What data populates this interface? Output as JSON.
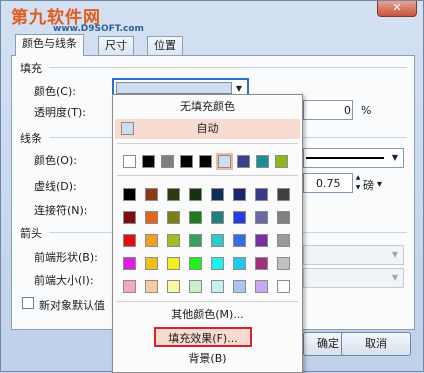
{
  "watermark": {
    "main": "第九软件网",
    "url": "www.D9SOFT.com"
  },
  "window": {
    "close_glyph": "✕"
  },
  "tabs": [
    {
      "label": "颜色与线条"
    },
    {
      "label": "尺寸"
    },
    {
      "label": "位置"
    }
  ],
  "fill": {
    "section": "填充",
    "color_label": "颜色(C):",
    "transparency_label": "透明度(T):",
    "transparency_value": "0",
    "transparency_unit": "%",
    "selected_color": "#cfddf1"
  },
  "line": {
    "section": "线条",
    "color_label": "颜色(O):",
    "dash_label": "虚线(D):",
    "connector_label": "连接符(N):",
    "weight_value": "0.75",
    "weight_unit": "磅"
  },
  "arrows": {
    "section": "箭头",
    "begin_style_label": "前端形状(B):",
    "begin_size_label": "前端大小(I):"
  },
  "default_checkbox_label": "新对象默认值",
  "buttons": {
    "ok": "确定",
    "cancel": "取消"
  },
  "popup": {
    "no_fill": "无填充颜色",
    "auto": "自动",
    "auto_color": "#cfddf1",
    "theme_colors": [
      "#ffffff",
      "#000000",
      "#7f7f7f",
      "#000000",
      "#000000",
      "#cfddf1",
      "#3a3f8f",
      "#1b8f8f",
      "#8fb81e"
    ],
    "standard_colors": [
      [
        "#000000",
        "#8b3a12",
        "#2b3b10",
        "#13320e",
        "#0d2f5a",
        "#1b2372",
        "#3a3a8a",
        "#404040"
      ],
      [
        "#7a0f0f",
        "#e0641a",
        "#7f7f1a",
        "#1f7a1f",
        "#1f7f7f",
        "#2a3ce0",
        "#6a6aa0",
        "#808080"
      ],
      [
        "#e01010",
        "#f0a020",
        "#9bc020",
        "#3aa060",
        "#30c8c8",
        "#3a6ae8",
        "#7a2fa0",
        "#9a9a9a"
      ],
      [
        "#e020e0",
        "#f0c020",
        "#f0f020",
        "#20f020",
        "#20f0f0",
        "#20c8f0",
        "#a0307a",
        "#c0c0c0"
      ],
      [
        "#f0a8c8",
        "#f8c8a0",
        "#f8f8a0",
        "#c8f0c8",
        "#c8f0f0",
        "#a8c8f0",
        "#c8a8f0",
        "#ffffff"
      ]
    ],
    "more_colors": "其他颜色(M)...",
    "fill_effects": "填充效果(F)...",
    "background": "背景(B)"
  }
}
